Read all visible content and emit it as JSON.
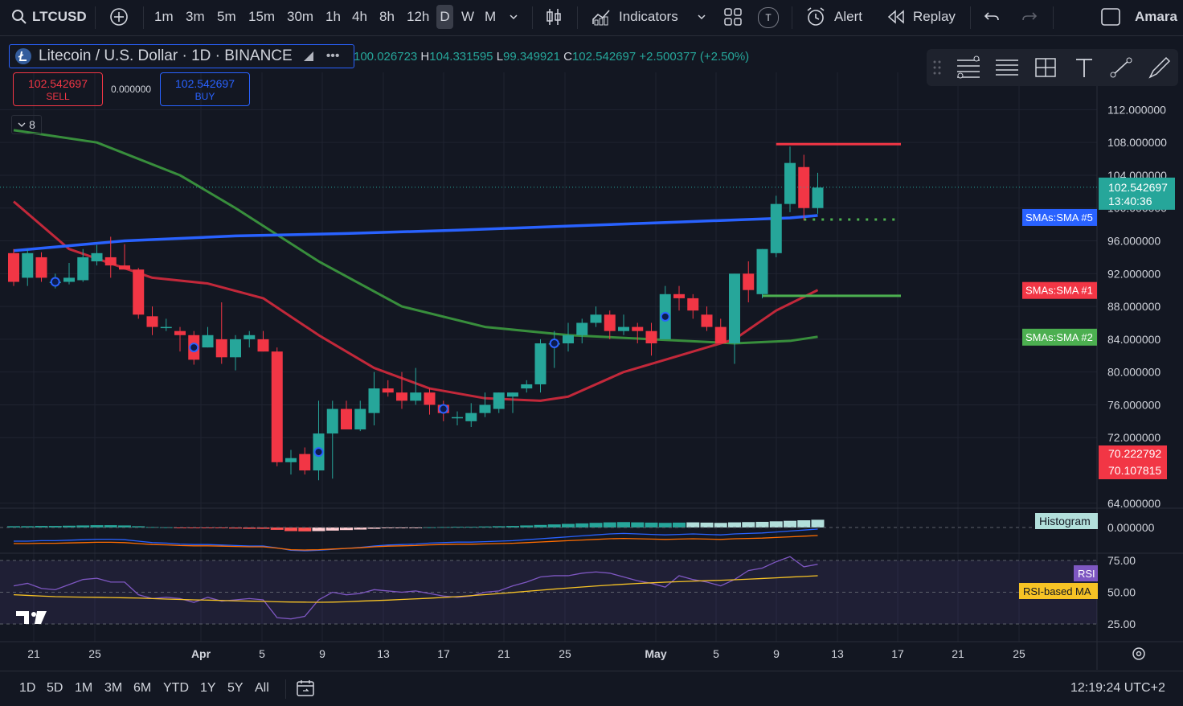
{
  "toolbar": {
    "symbol": "LTCUSD",
    "intervals": [
      "1m",
      "3m",
      "5m",
      "15m",
      "30m",
      "1h",
      "4h",
      "8h",
      "12h",
      "D",
      "W",
      "M"
    ],
    "active_interval": "D",
    "indicators_label": "Indicators",
    "alert_label": "Alert",
    "replay_label": "Replay",
    "user_name": "Amara",
    "t_badge": "T"
  },
  "legend": {
    "title": "Litecoin / U.S. Dollar · 1D · BINANCE",
    "open_key": "O",
    "open": "100.026723",
    "high_key": "H",
    "high": "104.331595",
    "low_key": "L",
    "low": "99.349921",
    "close_key": "C",
    "close": "102.542697",
    "change": "+2.500377 (+2.50%)",
    "sell_price": "102.542697",
    "sell_label": "SELL",
    "spread": "0.000000",
    "buy_price": "102.542697",
    "buy_label": "BUY",
    "collapsed_count": "8"
  },
  "colors": {
    "bg": "#131722",
    "up": "#26a69a",
    "down": "#f23645",
    "sma5": "#2962ff",
    "sma1": "#c2283a",
    "sma2": "#388e3c",
    "rsi": "#7e57c2",
    "rsi_ma": "#f7c325"
  },
  "chart_data": {
    "type": "candlestick",
    "price_axis": [
      "112.000000",
      "108.000000",
      "104.000000",
      "100.000000",
      "96.000000",
      "92.000000",
      "88.000000",
      "84.000000",
      "80.000000",
      "76.000000",
      "72.000000",
      "64.000000"
    ],
    "ylim": [
      63,
      114
    ],
    "last_price": "102.542697",
    "countdown": "13:40:36",
    "price_tags": [
      "70.222792",
      "70.107815"
    ],
    "time_axis": [
      "21",
      "25",
      "Apr",
      "5",
      "9",
      "13",
      "17",
      "21",
      "25",
      "May",
      "5",
      "9",
      "13",
      "17",
      "21",
      "25"
    ],
    "candles": [
      [
        94.5,
        95.0,
        90.5,
        91.0
      ],
      [
        91.5,
        95.0,
        90.5,
        94.5
      ],
      [
        94.0,
        94.6,
        91.0,
        91.5
      ],
      [
        91.0,
        92.0,
        90.2,
        91.0
      ],
      [
        91.0,
        93.3,
        90.7,
        91.5
      ],
      [
        91.2,
        95.0,
        91.0,
        94.0
      ],
      [
        93.5,
        95.5,
        93.0,
        94.5
      ],
      [
        94.0,
        96.5,
        91.5,
        93.0
      ],
      [
        93.0,
        95.6,
        92.5,
        92.5
      ],
      [
        92.5,
        92.7,
        86.5,
        87.0
      ],
      [
        86.8,
        88.0,
        84.5,
        85.5
      ],
      [
        85.5,
        86.5,
        85.0,
        85.5
      ],
      [
        85.0,
        85.5,
        82.5,
        84.5
      ],
      [
        84.5,
        85.0,
        80.9,
        81.5
      ],
      [
        83.0,
        85.5,
        83.0,
        84.5
      ],
      [
        84.0,
        88.5,
        81.0,
        81.8
      ],
      [
        81.8,
        84.5,
        80.2,
        84.0
      ],
      [
        84.0,
        85.0,
        83.0,
        84.5
      ],
      [
        84.0,
        85.0,
        82.5,
        82.5
      ],
      [
        82.5,
        83.0,
        68.5,
        69.0
      ],
      [
        69.0,
        70.5,
        67.5,
        69.5
      ],
      [
        70.0,
        70.8,
        67.5,
        68.0
      ],
      [
        68.0,
        76.5,
        66.8,
        72.5
      ],
      [
        72.5,
        76.5,
        67.0,
        75.5
      ],
      [
        75.5,
        76.5,
        73.0,
        73.0
      ],
      [
        73.0,
        76.5,
        72.8,
        75.5
      ],
      [
        75.0,
        80.0,
        73.5,
        78.0
      ],
      [
        78.0,
        79.0,
        77.0,
        77.5
      ],
      [
        77.5,
        80.0,
        75.5,
        76.5
      ],
      [
        76.5,
        80.5,
        76.0,
        77.5
      ],
      [
        77.5,
        78.0,
        74.8,
        76.0
      ],
      [
        76.0,
        76.5,
        74.0,
        75.0
      ],
      [
        74.5,
        75.2,
        73.5,
        74.5
      ],
      [
        74.0,
        76.2,
        73.3,
        75.0
      ],
      [
        75.0,
        77.5,
        74.5,
        76.0
      ],
      [
        75.5,
        77.5,
        75.0,
        77.5
      ],
      [
        77.0,
        77.5,
        75.0,
        77.5
      ],
      [
        78.0,
        79.0,
        77.5,
        78.5
      ],
      [
        78.5,
        84.0,
        77.5,
        83.5
      ],
      [
        83.5,
        85.0,
        80.5,
        83.5
      ],
      [
        83.5,
        86.0,
        82.5,
        84.5
      ],
      [
        84.5,
        86.5,
        83.5,
        86.0
      ],
      [
        86.0,
        88.0,
        85.5,
        87.0
      ],
      [
        87.0,
        87.5,
        84.0,
        85.0
      ],
      [
        85.0,
        87.0,
        84.5,
        85.5
      ],
      [
        85.5,
        86.0,
        83.5,
        85.0
      ],
      [
        85.0,
        86.0,
        82.0,
        83.5
      ],
      [
        84.0,
        90.5,
        84.0,
        89.5
      ],
      [
        89.5,
        90.5,
        87.5,
        89.0
      ],
      [
        89.0,
        89.5,
        86.5,
        87.5
      ],
      [
        87.0,
        88.0,
        85.0,
        85.5
      ],
      [
        85.5,
        86.5,
        84.0,
        83.5
      ],
      [
        83.5,
        92.0,
        81.0,
        92.0
      ],
      [
        92.0,
        93.5,
        88.5,
        90.0
      ],
      [
        89.5,
        95.0,
        89.0,
        95.0
      ],
      [
        94.5,
        101.5,
        94.0,
        100.5
      ],
      [
        100.5,
        107.5,
        99.5,
        105.5
      ],
      [
        105.0,
        106.5,
        98.5,
        100.0
      ],
      [
        100.0,
        104.3,
        99.3,
        102.5
      ]
    ],
    "markers": [
      3,
      13,
      22,
      31,
      39,
      47
    ],
    "sma5": [
      [
        0,
        94.8
      ],
      [
        8,
        96.0
      ],
      [
        16,
        96.6
      ],
      [
        24,
        96.9
      ],
      [
        32,
        97.3
      ],
      [
        40,
        97.8
      ],
      [
        48,
        98.3
      ],
      [
        56,
        98.8
      ],
      [
        58,
        99.1
      ]
    ],
    "sma1": [
      [
        0,
        100.8
      ],
      [
        4,
        95.0
      ],
      [
        10,
        91.5
      ],
      [
        14,
        90.8
      ],
      [
        18,
        89.0
      ],
      [
        22,
        84.5
      ],
      [
        26,
        80.5
      ],
      [
        30,
        78.0
      ],
      [
        34,
        76.8
      ],
      [
        38,
        76.5
      ],
      [
        40,
        77.0
      ],
      [
        44,
        80.0
      ],
      [
        48,
        82.0
      ],
      [
        52,
        84.0
      ],
      [
        55,
        87.5
      ],
      [
        58,
        90.0
      ]
    ],
    "sma2": [
      [
        0,
        109.5
      ],
      [
        6,
        108.0
      ],
      [
        12,
        104.0
      ],
      [
        16,
        100.0
      ],
      [
        22,
        93.5
      ],
      [
        28,
        88.0
      ],
      [
        34,
        85.5
      ],
      [
        40,
        84.5
      ],
      [
        46,
        84.0
      ],
      [
        52,
        83.5
      ],
      [
        56,
        83.8
      ],
      [
        58,
        84.3
      ]
    ],
    "sma_labels": [
      "SMAs:SMA #5",
      "SMAs:SMA #1",
      "SMAs:SMA #2"
    ],
    "hlines": [
      {
        "price": 107.8,
        "from": 55,
        "to": 64,
        "style": "solid",
        "color": "#f23645"
      },
      {
        "price": 98.6,
        "from": 57,
        "to": 64,
        "style": "dotted",
        "color": "#4caf50"
      },
      {
        "price": 89.3,
        "from": 54,
        "to": 64,
        "style": "solid",
        "color": "#4caf50"
      }
    ],
    "macd": {
      "label": "Histogram",
      "zero": "0.000000",
      "hist": [
        0.5,
        0.5,
        0.6,
        0.6,
        0.7,
        0.8,
        0.9,
        0.9,
        0.8,
        0.5,
        0.2,
        0.1,
        -0.1,
        -0.2,
        -0.2,
        -0.3,
        -0.4,
        -0.5,
        -0.5,
        -0.9,
        -1.4,
        -1.5,
        -1.4,
        -1.2,
        -1.0,
        -0.8,
        -0.5,
        -0.3,
        -0.2,
        -0.1,
        0.1,
        0.2,
        0.3,
        0.3,
        0.4,
        0.5,
        0.6,
        0.8,
        1.0,
        1.2,
        1.4,
        1.6,
        1.8,
        2.0,
        2.1,
        2.0,
        1.9,
        1.8,
        1.9,
        2.0,
        1.9,
        1.8,
        2.0,
        2.1,
        2.2,
        2.4,
        2.6,
        2.8,
        3.0
      ]
    },
    "rsi": {
      "label": "RSI",
      "ma_label": "RSI-based MA",
      "levels": [
        "75.00",
        "50.00",
        "25.00"
      ],
      "values": [
        55,
        57,
        53,
        52,
        56,
        60,
        61,
        58,
        58,
        48,
        45,
        46,
        45,
        42,
        46,
        43,
        44,
        45,
        44,
        30,
        29,
        31,
        44,
        50,
        48,
        49,
        52,
        51,
        50,
        51,
        49,
        47,
        46,
        47,
        50,
        51,
        55,
        58,
        62,
        63,
        63,
        65,
        66,
        65,
        62,
        59,
        57,
        54,
        63,
        60,
        58,
        55,
        60,
        67,
        69,
        74,
        78,
        70,
        72
      ],
      "ma": [
        48,
        47.5,
        47,
        46.5,
        46.3,
        46.1,
        46,
        45.8,
        45.6,
        45.4,
        45,
        44.6,
        44.3,
        44,
        43.8,
        43.5,
        43.2,
        43,
        42.8,
        42.5,
        42.3,
        42.2,
        42.1,
        42.2,
        42.5,
        43,
        43.4,
        43.8,
        44.3,
        44.8,
        45.3,
        45.9,
        46.5,
        47.3,
        48.1,
        48.9,
        49.8,
        50.7,
        51.6,
        52.5,
        53.3,
        54.1,
        54.9,
        55.6,
        56.3,
        56.9,
        57.4,
        57.9,
        58.3,
        58.7,
        59.1,
        59.4,
        59.8,
        60.3,
        60.8,
        61.3,
        61.9,
        62.4,
        63
      ]
    }
  },
  "bottombar": {
    "ranges": [
      "1D",
      "5D",
      "1M",
      "3M",
      "6M",
      "YTD",
      "1Y",
      "5Y",
      "All"
    ],
    "clock": "12:19:24 UTC+2"
  }
}
